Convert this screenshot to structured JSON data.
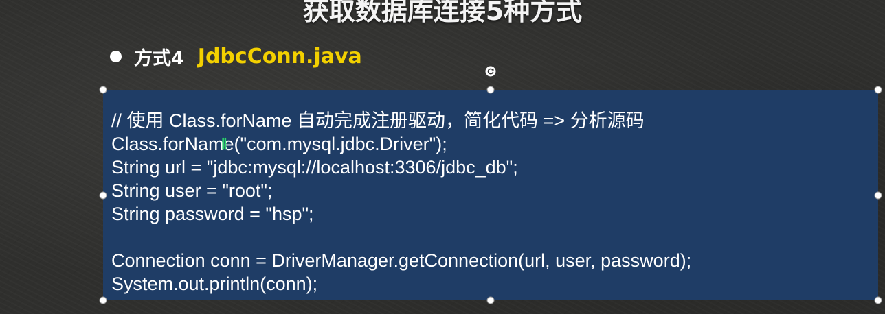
{
  "slide": {
    "title": "获取数据库连接5种方式"
  },
  "bullet": {
    "label": "方式4",
    "file": "JdbcConn.java"
  },
  "code": {
    "lines": [
      "// 使用 Class.forName 自动完成注册驱动，简化代码 => 分析源码",
      "Class.forName(\"com.mysql.jdbc.Driver\");",
      "String url = \"jdbc:mysql://localhost:3306/jdbc_db\";",
      "String user = \"root\";",
      "String password = \"hsp\";",
      "",
      "Connection conn = DriverManager.getConnection(url, user, password);",
      "System.out.println(conn);"
    ]
  },
  "colors": {
    "code_background": "#1f3d66",
    "file_name": "#f3d000",
    "text": "#ffffff"
  },
  "icons": {
    "rotate": "rotate-icon",
    "bullet": "bullet-dot-icon",
    "cursor": "text-cursor-icon"
  }
}
